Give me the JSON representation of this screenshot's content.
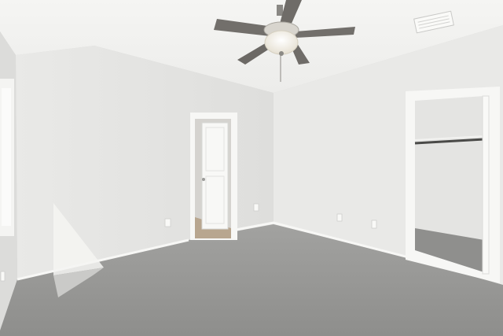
{
  "scene": {
    "description_colors": {
      "ceiling": "#f3f3f1",
      "wall_left": "#e4e4e2",
      "wall_back": "#ebebe9",
      "wall_right": "#e7e7e5",
      "carpet": "#9a9a98",
      "trim": "#f7f7f5",
      "fan_blade": "#6f6d69",
      "fan_globe": "#f6f3ea"
    },
    "icons": [
      "ceiling-fan-icon",
      "air-vent-icon",
      "door-icon",
      "closet-rod-icon",
      "outlet-icon"
    ]
  }
}
